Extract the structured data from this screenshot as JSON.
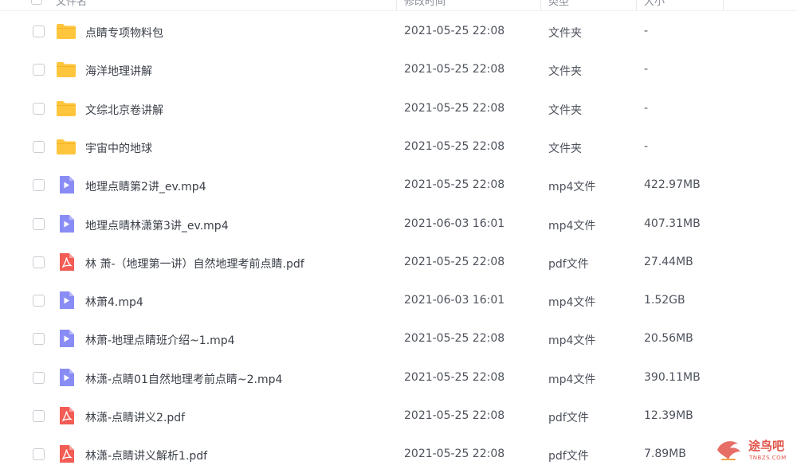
{
  "header": {
    "name_label": "文件名",
    "date_label": "修改时间",
    "type_label": "类型",
    "size_label": "大小"
  },
  "files": [
    {
      "name": "点睛专项物料包",
      "date": "2021-05-25 22:08",
      "type": "文件夹",
      "size": "-",
      "icon": "folder-icon"
    },
    {
      "name": "海洋地理讲解",
      "date": "2021-05-25 22:08",
      "type": "文件夹",
      "size": "-",
      "icon": "folder-icon"
    },
    {
      "name": "文综北京卷讲解",
      "date": "2021-05-25 22:08",
      "type": "文件夹",
      "size": "-",
      "icon": "folder-icon"
    },
    {
      "name": "宇宙中的地球",
      "date": "2021-05-25 22:08",
      "type": "文件夹",
      "size": "-",
      "icon": "folder-icon"
    },
    {
      "name": "地理点睛第2讲_ev.mp4",
      "date": "2021-05-25 22:08",
      "type": "mp4文件",
      "size": "422.97MB",
      "icon": "video-file-icon"
    },
    {
      "name": "地理点晴林潇第3讲_ev.mp4",
      "date": "2021-06-03 16:01",
      "type": "mp4文件",
      "size": "407.31MB",
      "icon": "video-file-icon"
    },
    {
      "name": "林 萧-（地理第一讲）自然地理考前点睛.pdf",
      "date": "2021-05-25 22:08",
      "type": "pdf文件",
      "size": "27.44MB",
      "icon": "pdf-file-icon"
    },
    {
      "name": "林萧4.mp4",
      "date": "2021-06-03 16:01",
      "type": "mp4文件",
      "size": "1.52GB",
      "icon": "video-file-icon"
    },
    {
      "name": "林萧-地理点睛班介绍~1.mp4",
      "date": "2021-05-25 22:08",
      "type": "mp4文件",
      "size": "20.56MB",
      "icon": "video-file-icon"
    },
    {
      "name": "林潇-点睛01自然地理考前点睛~2.mp4",
      "date": "2021-05-25 22:08",
      "type": "mp4文件",
      "size": "390.11MB",
      "icon": "video-file-icon"
    },
    {
      "name": "林潇-点睛讲义2.pdf",
      "date": "2021-05-25 22:08",
      "type": "pdf文件",
      "size": "12.39MB",
      "icon": "pdf-file-icon"
    },
    {
      "name": "林潇-点睛讲义解析1.pdf",
      "date": "2021-05-25 22:08",
      "type": "pdf文件",
      "size": "7.89MB",
      "icon": "pdf-file-icon"
    }
  ],
  "watermark": {
    "text": "途鸟吧",
    "sub": "TNBZS.COM"
  },
  "colors": {
    "folder": "#ffc53d",
    "video": "#8a8cf5",
    "pdf": "#f25c54",
    "watermark": "#e2554b"
  }
}
